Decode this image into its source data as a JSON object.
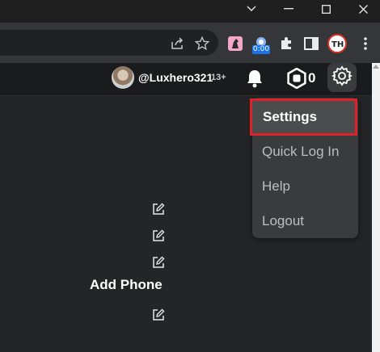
{
  "window": {
    "minimize_glyph": "—",
    "dropdown_glyph": "⌄"
  },
  "toolbar": {
    "icons": [
      "share-icon",
      "star-bookmark-icon",
      "extension-puzzle-icon",
      "side-panel-icon",
      "menu-kebab-icon"
    ],
    "ext_badge": "0:00"
  },
  "header": {
    "username": "@Luxhero321",
    "age_badge": "13+",
    "robux_count": "0"
  },
  "settings_menu": {
    "items": [
      {
        "label": "Settings"
      },
      {
        "label": "Quick Log In"
      },
      {
        "label": "Help"
      },
      {
        "label": "Logout"
      }
    ]
  },
  "content": {
    "add_phone_label": "Add Phone"
  },
  "colors": {
    "page_bg": "#232527",
    "header_bg": "#191b1d",
    "menu_bg": "#393b3d",
    "highlight_border": "#e0202a"
  }
}
